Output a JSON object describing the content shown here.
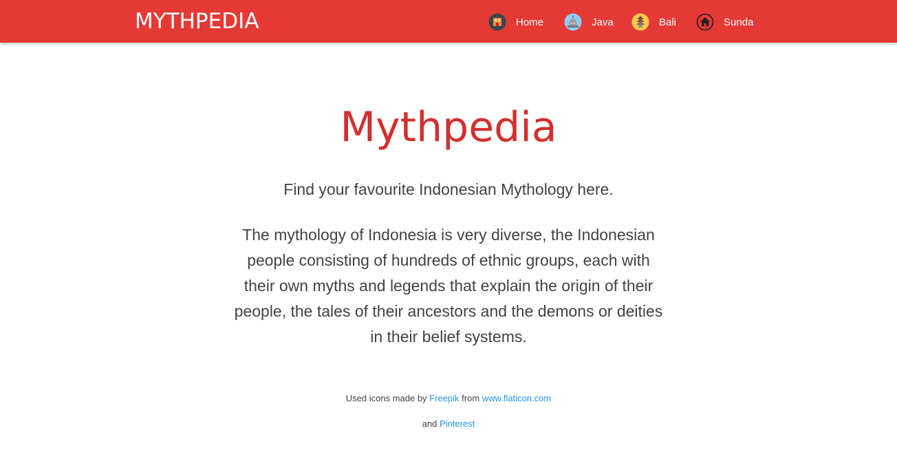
{
  "navbar": {
    "brand": "MYTHPEDIA",
    "items": [
      {
        "label": "Home",
        "icon": "home-icon"
      },
      {
        "label": "Java",
        "icon": "java-temple-icon"
      },
      {
        "label": "Bali",
        "icon": "bali-temple-icon"
      },
      {
        "label": "Sunda",
        "icon": "sunda-house-icon"
      }
    ],
    "background_color": "#e53935"
  },
  "hero": {
    "title": "Mythpedia",
    "subtitle": "Find your favourite Indonesian Mythology here.",
    "description": "The mythology of Indonesia is very diverse, the Indonesian people consisting of hundreds of ethnic groups, each with their own myths and legends that explain the origin of their people, the tales of their ancestors and the demons or deities in their belief systems.",
    "title_color": "#d32f2f"
  },
  "credits": {
    "line1_prefix": "Used icons made by ",
    "line1_link1": "Freepik",
    "line1_middle": " from ",
    "line1_link2": "www.flaticon.com",
    "line2_prefix": "and ",
    "line2_link": "Pinterest",
    "link_color": "#2196f3"
  }
}
